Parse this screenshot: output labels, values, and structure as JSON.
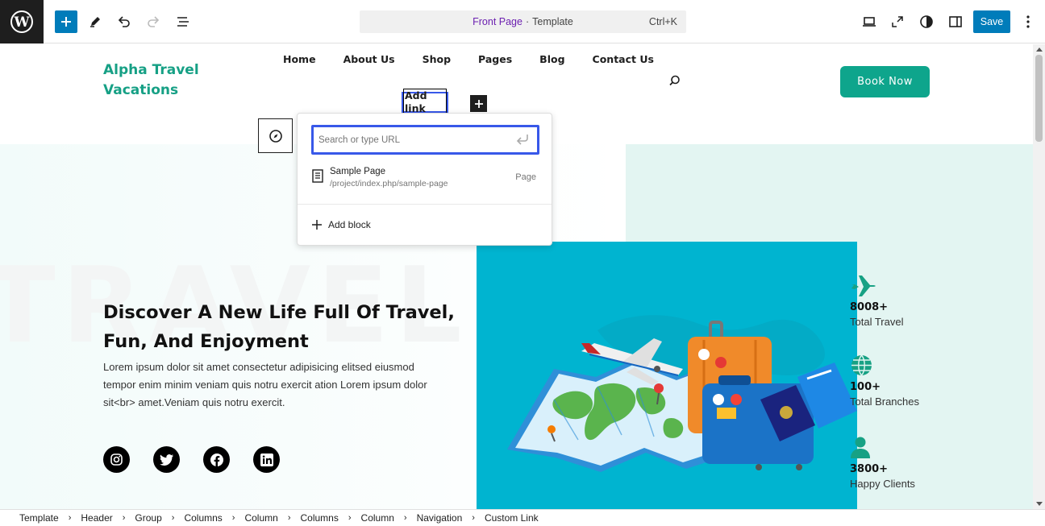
{
  "toolbar": {
    "doc_type": "Front Page",
    "doc_sep": "·",
    "doc_template": "Template",
    "shortcut": "Ctrl+K",
    "save_label": "Save"
  },
  "header": {
    "brand_line1": "Alpha Travel",
    "brand_line2": "Vacations",
    "nav": [
      "Home",
      "About Us",
      "Shop",
      "Pages",
      "Blog",
      "Contact Us"
    ],
    "add_link": "Add link",
    "book_label": "Book Now"
  },
  "link_popover": {
    "placeholder": "Search or type URL",
    "suggestion_title": "Sample Page",
    "suggestion_url": "/project/index.php/sample-page",
    "suggestion_type": "Page",
    "add_block": "Add block"
  },
  "hero": {
    "title": "Discover A New Life Full Of Travel, Fun, And Enjoyment",
    "text": "Lorem ipsum dolor sit amet consectetur adipisicing elitsed eiusmod tempor enim minim veniam quis notru exercit ation Lorem ipsum dolor sit<br> amet.Veniam quis notru exercit.",
    "watermark": "TRAVEL"
  },
  "stats": [
    {
      "value": "8008+",
      "label": "Total Travel",
      "icon": "plane-icon"
    },
    {
      "value": "100+",
      "label": "Total Branches",
      "icon": "globe-icon"
    },
    {
      "value": "3800+",
      "label": "Happy Clients",
      "icon": "user-icon"
    }
  ],
  "breadcrumb": [
    "Template",
    "Header",
    "Group",
    "Columns",
    "Column",
    "Columns",
    "Column",
    "Navigation",
    "Custom Link"
  ],
  "colors": {
    "accent": "#16a085",
    "wp_blue": "#007cba",
    "selection": "#3858e9",
    "hero_image_bg": "#00b4d0"
  }
}
